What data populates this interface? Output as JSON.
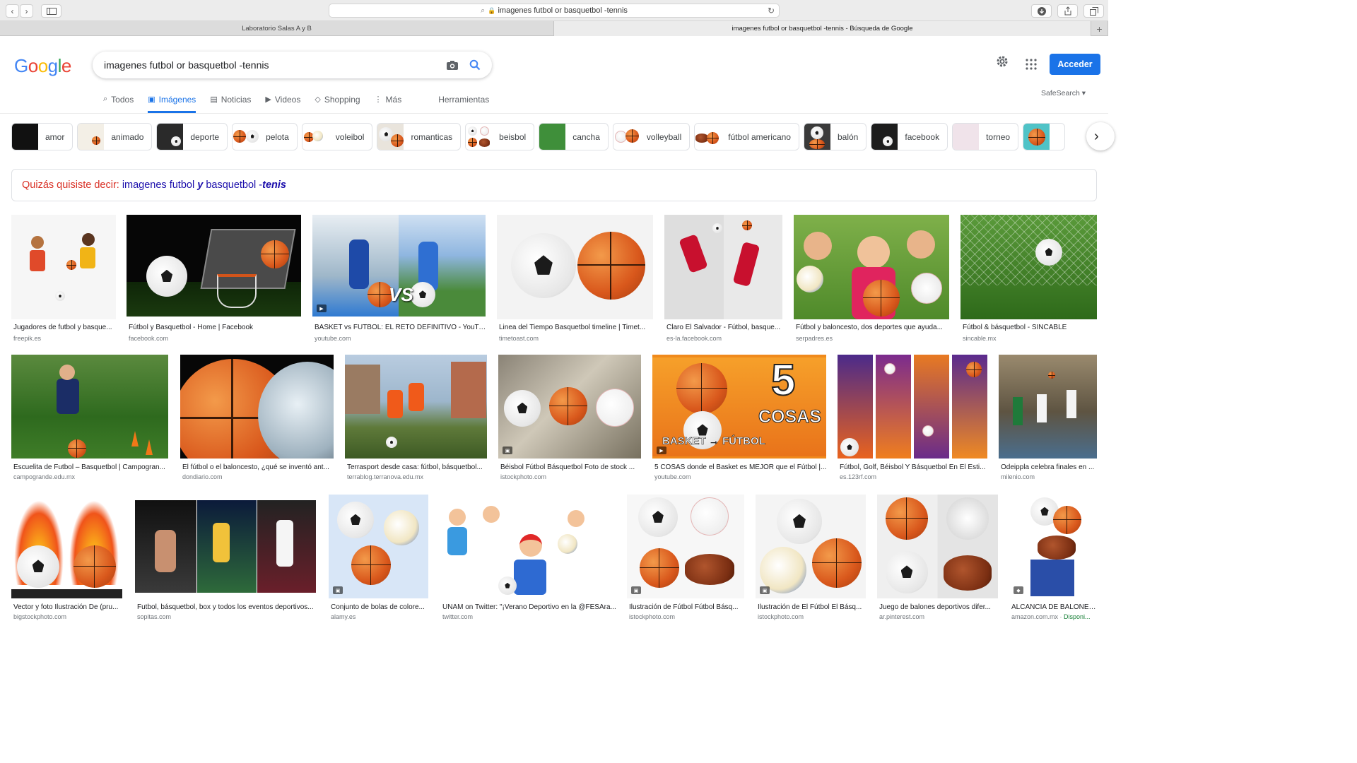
{
  "browser": {
    "address": "imagenes futbol or basquetbol -tennis",
    "tabs": [
      {
        "label": "Laboratorio Salas A y B"
      },
      {
        "label": "imagenes futbol or basquetbol -tennis - Búsqueda de Google"
      }
    ]
  },
  "google": {
    "logo": "Google",
    "query": "imagenes futbol or basquetbol -tennis",
    "signin": "Acceder",
    "safesearch": "SafeSearch ▾",
    "nav": [
      {
        "label": "Todos",
        "icon": "search-icon"
      },
      {
        "label": "Imágenes",
        "icon": "image-icon"
      },
      {
        "label": "Noticias",
        "icon": "news-icon"
      },
      {
        "label": "Videos",
        "icon": "play-icon"
      },
      {
        "label": "Shopping",
        "icon": "tag-icon"
      },
      {
        "label": "Más",
        "icon": "more-icon"
      },
      {
        "label": "Herramientas",
        "icon": ""
      }
    ]
  },
  "chips": [
    "amor",
    "animado",
    "deporte",
    "pelota",
    "voleibol",
    "romanticas",
    "beisbol",
    "cancha",
    "volleyball",
    "fútbol americano",
    "balón",
    "facebook",
    "torneo",
    ""
  ],
  "didyoumean": {
    "label": "Quizás quisiste decir:",
    "part1": "imagenes futbol ",
    "bold1": "y",
    "part2": " basquetbol -",
    "bold2": "tenis"
  },
  "results": [
    {
      "title": "Jugadores de futbol y basque...",
      "source": "freepik.es"
    },
    {
      "title": "Fútbol y Basquetbol - Home | Facebook",
      "source": "facebook.com"
    },
    {
      "title": "BASKET vs FUTBOL: EL RETO DEFINITIVO - YouTube",
      "source": "youtube.com"
    },
    {
      "title": "Linea del Tiempo Basquetbol timeline | Timet...",
      "source": "timetoast.com"
    },
    {
      "title": "Claro El Salvador - Fútbol, basque...",
      "source": "es-la.facebook.com"
    },
    {
      "title": "Fútbol y baloncesto, dos deportes que ayuda...",
      "source": "serpadres.es"
    },
    {
      "title": "Fútbol & básquetbol - SINCABLE",
      "source": "sincable.mx"
    },
    {
      "title": "Escuelita de Futbol – Basquetbol | Campogran...",
      "source": "campogrande.edu.mx"
    },
    {
      "title": "El fútbol o el baloncesto, ¿qué se inventó ant...",
      "source": "dondiario.com"
    },
    {
      "title": "Terrasport desde casa: fútbol, básquetbol...",
      "source": "terrablog.terranova.edu.mx"
    },
    {
      "title": "Béisbol Fútbol Básquetbol Foto de stock ...",
      "source": "istockphoto.com"
    },
    {
      "title": "5 COSAS donde el Basket es MEJOR que el Fútbol |...",
      "source": "youtube.com"
    },
    {
      "title": "Fútbol, Golf, Béisbol Y Básquetbol En El Esti...",
      "source": "es.123rf.com"
    },
    {
      "title": "Odeipplа celebra finales en ...",
      "source": "milenio.com"
    },
    {
      "title": "Vector y foto Ilustración De (pru...",
      "source": "bigstockphoto.com"
    },
    {
      "title": "Futbol, básquetbol, box y todos los eventos deportivos...",
      "source": "sopitas.com"
    },
    {
      "title": "Conjunto de bolas de colore...",
      "source": "alamy.es"
    },
    {
      "title": "UNAM on Twitter: \"¡Verano Deportivo en la @FESAra...",
      "source": "twitter.com"
    },
    {
      "title": "Ilustración de Fútbol Fútbol Básq...",
      "source": "istockphoto.com"
    },
    {
      "title": "Ilustración de El Fútbol El Básq...",
      "source": "istockphoto.com"
    },
    {
      "title": "Juego de balones deportivos difer...",
      "source": "ar.pinterest.com"
    },
    {
      "title": "ALCANCIA DE BALONES...",
      "source": "amazon.com.mx",
      "badge": "Disponi..."
    }
  ],
  "overlays": {
    "cosas_big": "5",
    "cosas_word": "COSAS",
    "cosas_banner": "BASKET → FÚTBOL",
    "vs": "VS"
  }
}
